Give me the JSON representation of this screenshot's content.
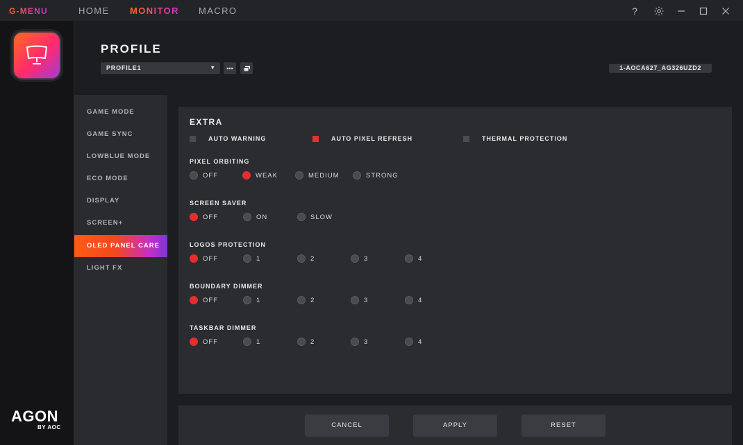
{
  "titlebar": {
    "brand": "G-MENU",
    "tabs": [
      {
        "label": "HOME",
        "active": false
      },
      {
        "label": "MONITOR",
        "active": true
      },
      {
        "label": "MACRO",
        "active": false
      }
    ],
    "icons": [
      "help-icon",
      "gear-icon",
      "minimize-icon",
      "maximize-icon",
      "close-icon"
    ]
  },
  "rail": {
    "logo_word": "AGON",
    "logo_by": "BY AOC"
  },
  "profile": {
    "title": "PROFILE",
    "selected": "PROFILE1",
    "more_label": "•••",
    "model": "1-AOCA627_AG326UZD2"
  },
  "menu": {
    "items": [
      {
        "label": "GAME MODE",
        "active": false
      },
      {
        "label": "GAME SYNC",
        "active": false
      },
      {
        "label": "LOWBLUE MODE",
        "active": false
      },
      {
        "label": "ECO MODE",
        "active": false
      },
      {
        "label": "DISPLAY",
        "active": false
      },
      {
        "label": "SCREEN+",
        "active": false
      },
      {
        "label": "OLED PANEL CARE",
        "active": true
      },
      {
        "label": "LIGHT FX",
        "active": false
      }
    ]
  },
  "extra": {
    "title": "EXTRA",
    "checks": [
      {
        "label": "AUTO WARNING",
        "checked": false
      },
      {
        "label": "AUTO PIXEL REFRESH",
        "checked": true
      },
      {
        "label": "THERMAL PROTECTION",
        "checked": false
      }
    ],
    "groups": [
      {
        "label": "PIXEL ORBITING",
        "options": [
          "OFF",
          "WEAK",
          "MEDIUM",
          "STRONG"
        ],
        "selected": 1
      },
      {
        "label": "SCREEN SAVER",
        "options": [
          "OFF",
          "ON",
          "SLOW"
        ],
        "selected": 0
      },
      {
        "label": "LOGOS PROTECTION",
        "options": [
          "OFF",
          "1",
          "2",
          "3",
          "4"
        ],
        "selected": 0
      },
      {
        "label": "BOUNDARY DIMMER",
        "options": [
          "OFF",
          "1",
          "2",
          "3",
          "4"
        ],
        "selected": 0
      },
      {
        "label": "TASKBAR DIMMER",
        "options": [
          "OFF",
          "1",
          "2",
          "3",
          "4"
        ],
        "selected": 0
      }
    ]
  },
  "footer": {
    "cancel": "CANCEL",
    "apply": "APPLY",
    "reset": "RESET"
  },
  "colors": {
    "accent_red": "#e62e2e",
    "accent_orange": "#ff5b16",
    "accent_purple": "#7e35d8"
  }
}
